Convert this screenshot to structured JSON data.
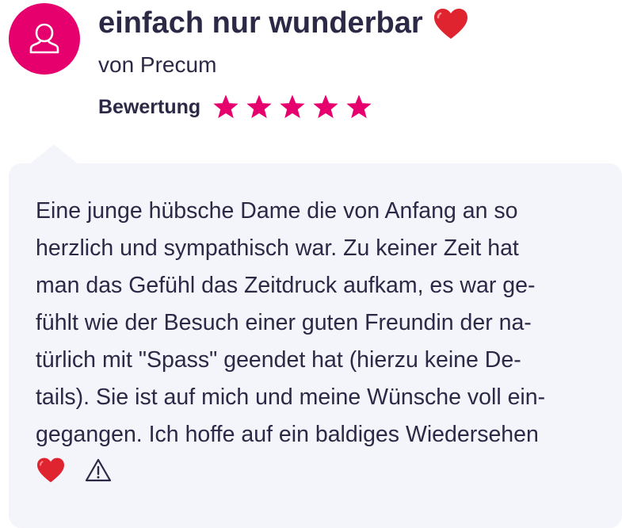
{
  "review": {
    "title": "einfach nur wunderbar",
    "title_emoji": "heart-icon",
    "author": "von Precum",
    "rating_label": "Bewertung",
    "rating": 5,
    "rating_max": 5,
    "text_lines": [
      "Eine junge hübsche Dame die von Anfang an so",
      "herzlich und sympathisch war. Zu keiner Zeit hat",
      "man das Gefühl das Zeitdruck aufkam, es war ge-",
      "fühlt wie der Besuch einer guten Freundin der na-",
      "türlich mit \"Spass\" geendet hat (hierzu keine De-",
      "tails). Sie ist auf mich und meine Wünsche voll ein-",
      "gegangen. Ich hoffe auf ein baldiges Wiedersehen"
    ],
    "end_emoji": "heart-icon",
    "report_icon": "warning-icon"
  },
  "colors": {
    "accent": "#e6006e",
    "text": "#2b2946",
    "bubble_bg": "#f4f4fb",
    "heart": "#e0242f"
  }
}
